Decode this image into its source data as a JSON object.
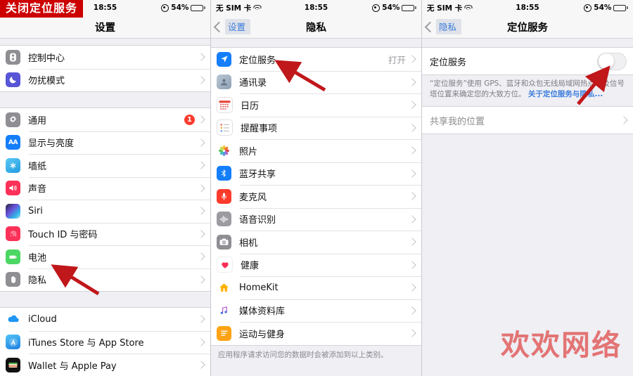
{
  "banner": {
    "text": "关闭定位服务"
  },
  "watermark": {
    "text": "欢欢网络"
  },
  "status": {
    "carrier": "无 SIM 卡",
    "time": "18:55",
    "battery": "54%",
    "battery_pct": 54
  },
  "panel1": {
    "nav": {
      "title": "设置"
    },
    "groups": [
      {
        "rows": [
          {
            "label": "控制中心",
            "icon": "control-center-icon",
            "value": "",
            "badge": ""
          },
          {
            "label": "勿扰模式",
            "icon": "do-not-disturb-icon",
            "value": "",
            "badge": ""
          }
        ]
      },
      {
        "rows": [
          {
            "label": "通用",
            "icon": "general-gear-icon",
            "value": "",
            "badge": "1"
          },
          {
            "label": "显示与亮度",
            "icon": "display-brightness-icon",
            "value": "",
            "badge": ""
          },
          {
            "label": "墙纸",
            "icon": "wallpaper-icon",
            "value": "",
            "badge": ""
          },
          {
            "label": "声音",
            "icon": "sound-icon",
            "value": "",
            "badge": ""
          },
          {
            "label": "Siri",
            "icon": "siri-icon",
            "value": "",
            "badge": ""
          },
          {
            "label": "Touch ID 与密码",
            "icon": "touch-id-icon",
            "value": "",
            "badge": ""
          },
          {
            "label": "电池",
            "icon": "battery-icon",
            "value": "",
            "badge": ""
          },
          {
            "label": "隐私",
            "icon": "privacy-hand-icon",
            "value": "",
            "badge": ""
          }
        ]
      },
      {
        "rows": [
          {
            "label": "iCloud",
            "icon": "icloud-icon",
            "value": "",
            "badge": ""
          },
          {
            "label": "iTunes Store 与 App Store",
            "icon": "app-store-icon",
            "value": "",
            "badge": ""
          },
          {
            "label": "Wallet 与 Apple Pay",
            "icon": "wallet-icon",
            "value": "",
            "badge": ""
          }
        ]
      }
    ]
  },
  "panel2": {
    "nav": {
      "back": "设置",
      "title": "隐私"
    },
    "rows": [
      {
        "label": "定位服务",
        "icon": "location-services-icon",
        "value": "打开"
      },
      {
        "label": "通讯录",
        "icon": "contacts-icon",
        "value": ""
      },
      {
        "label": "日历",
        "icon": "calendar-icon",
        "value": ""
      },
      {
        "label": "提醒事项",
        "icon": "reminders-icon",
        "value": ""
      },
      {
        "label": "照片",
        "icon": "photos-icon",
        "value": ""
      },
      {
        "label": "蓝牙共享",
        "icon": "bluetooth-icon",
        "value": ""
      },
      {
        "label": "麦克风",
        "icon": "microphone-icon",
        "value": ""
      },
      {
        "label": "语音识别",
        "icon": "speech-recognition-icon",
        "value": ""
      },
      {
        "label": "相机",
        "icon": "camera-icon",
        "value": ""
      },
      {
        "label": "健康",
        "icon": "health-icon",
        "value": ""
      },
      {
        "label": "HomeKit",
        "icon": "homekit-icon",
        "value": ""
      },
      {
        "label": "媒体资料库",
        "icon": "media-library-icon",
        "value": ""
      },
      {
        "label": "运动与健身",
        "icon": "fitness-icon",
        "value": ""
      }
    ],
    "footer": "应用程序请求访问您的数据时会被添加到以上类别。"
  },
  "panel3": {
    "nav": {
      "back": "隐私",
      "title": "定位服务"
    },
    "toggle_row": {
      "label": "定位服务",
      "state": "off"
    },
    "description": "“定位服务”使用 GPS、蓝牙和众包无线局域网热点以及信号塔位置来确定您的大致方位。",
    "description_link": "关于定位服务与隐私...",
    "share_row": {
      "label": "共享我的位置"
    }
  }
}
